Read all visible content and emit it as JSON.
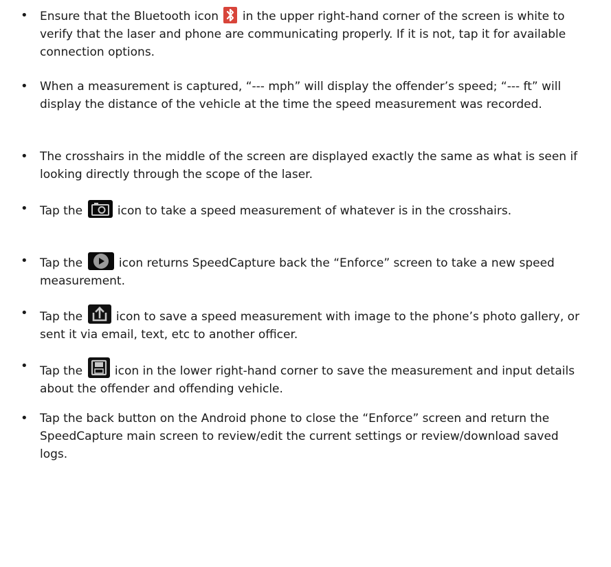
{
  "bullet_char": "•",
  "items": [
    {
      "id": "bluetooth",
      "before": "Ensure that the Bluetooth icon ",
      "icon": "bluetooth-icon",
      "after": " in the upper right-hand corner of the screen is white to verify that the laser and phone are communicating properly.  If it is not, tap it for available connection options."
    },
    {
      "id": "measurement",
      "before": "When a measurement is captured, “--- mph” will display the offender’s speed; “--- ft” will display the distance of the vehicle at the time the speed measurement was recorded.",
      "icon": "",
      "after": ""
    },
    {
      "id": "crosshairs",
      "before": "The crosshairs in the middle of the screen are displayed exactly the same as what is seen if looking directly through the scope of the laser.",
      "icon": "",
      "after": ""
    },
    {
      "id": "camera",
      "before": "Tap the ",
      "icon": "camera-icon",
      "after": " icon to take a speed measurement of whatever is in the crosshairs."
    },
    {
      "id": "play",
      "before": "Tap the ",
      "icon": "play-icon",
      "after": " icon returns SpeedCapture back the “Enforce” screen to take a new speed measurement."
    },
    {
      "id": "share",
      "before": "Tap the ",
      "icon": "share-icon",
      "after": " icon to save a speed measurement with image to the phone’s photo gallery, or sent it via email, text, etc to another officer."
    },
    {
      "id": "save",
      "before": "Tap the ",
      "icon": "save-icon",
      "after": " icon in the lower right-hand corner to save the measurement and input details about the offender and offending vehicle."
    },
    {
      "id": "back",
      "before": "Tap the back button on the Android phone to close the “Enforce” screen and return the SpeedCapture main screen to review/edit the current settings or review/download saved logs.",
      "icon": "",
      "after": ""
    }
  ],
  "colors": {
    "text": "#1a1a1a",
    "bluetooth_icon_bg": "#d8443a",
    "app_icon_bg": "#0a0a0a",
    "app_icon_glyph": "#c8c8c8"
  }
}
